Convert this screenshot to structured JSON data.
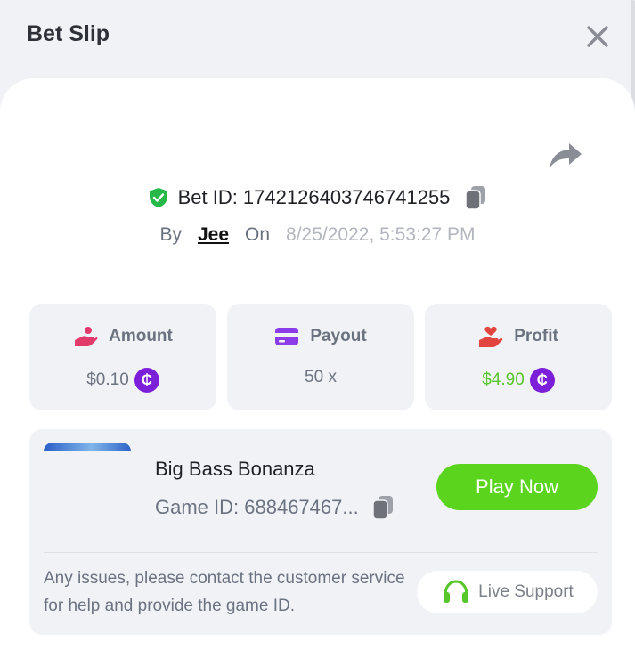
{
  "header": {
    "title": "Bet Slip"
  },
  "bet": {
    "id_label": "Bet ID: 1742126403746741255",
    "by_label": "By",
    "user": "Jee",
    "on_label": "On",
    "date": "8/25/2022, 5:53:27 PM"
  },
  "stats": {
    "amount": {
      "label": "Amount",
      "value": "$0.10",
      "currency_symbol": "₵"
    },
    "payout": {
      "label": "Payout",
      "value": "50 x"
    },
    "profit": {
      "label": "Profit",
      "value": "$4.90",
      "currency_symbol": "₵"
    }
  },
  "game": {
    "name": "Big Bass Bonanza",
    "id_label": "Game ID: 688467467...",
    "play_label": "Play Now",
    "note": "Any issues, please contact the customer service for help and provide the game ID.",
    "support_label": "Live Support"
  },
  "colors": {
    "accent_green": "#5ad41c",
    "profit_green": "#56c629",
    "coin_purple": "#7b1fd9",
    "amount_pink": "#e23a6b",
    "payout_purple": "#8b3be8",
    "profit_red": "#e2453f",
    "shield_green": "#27b84a"
  },
  "icons": {
    "close": "close-icon",
    "share": "share-icon",
    "shield": "shield-check-icon",
    "copy": "copy-icon",
    "amount": "hand-coins-icon",
    "payout": "credit-card-icon",
    "profit": "hand-heart-icon",
    "support": "headset-icon"
  }
}
